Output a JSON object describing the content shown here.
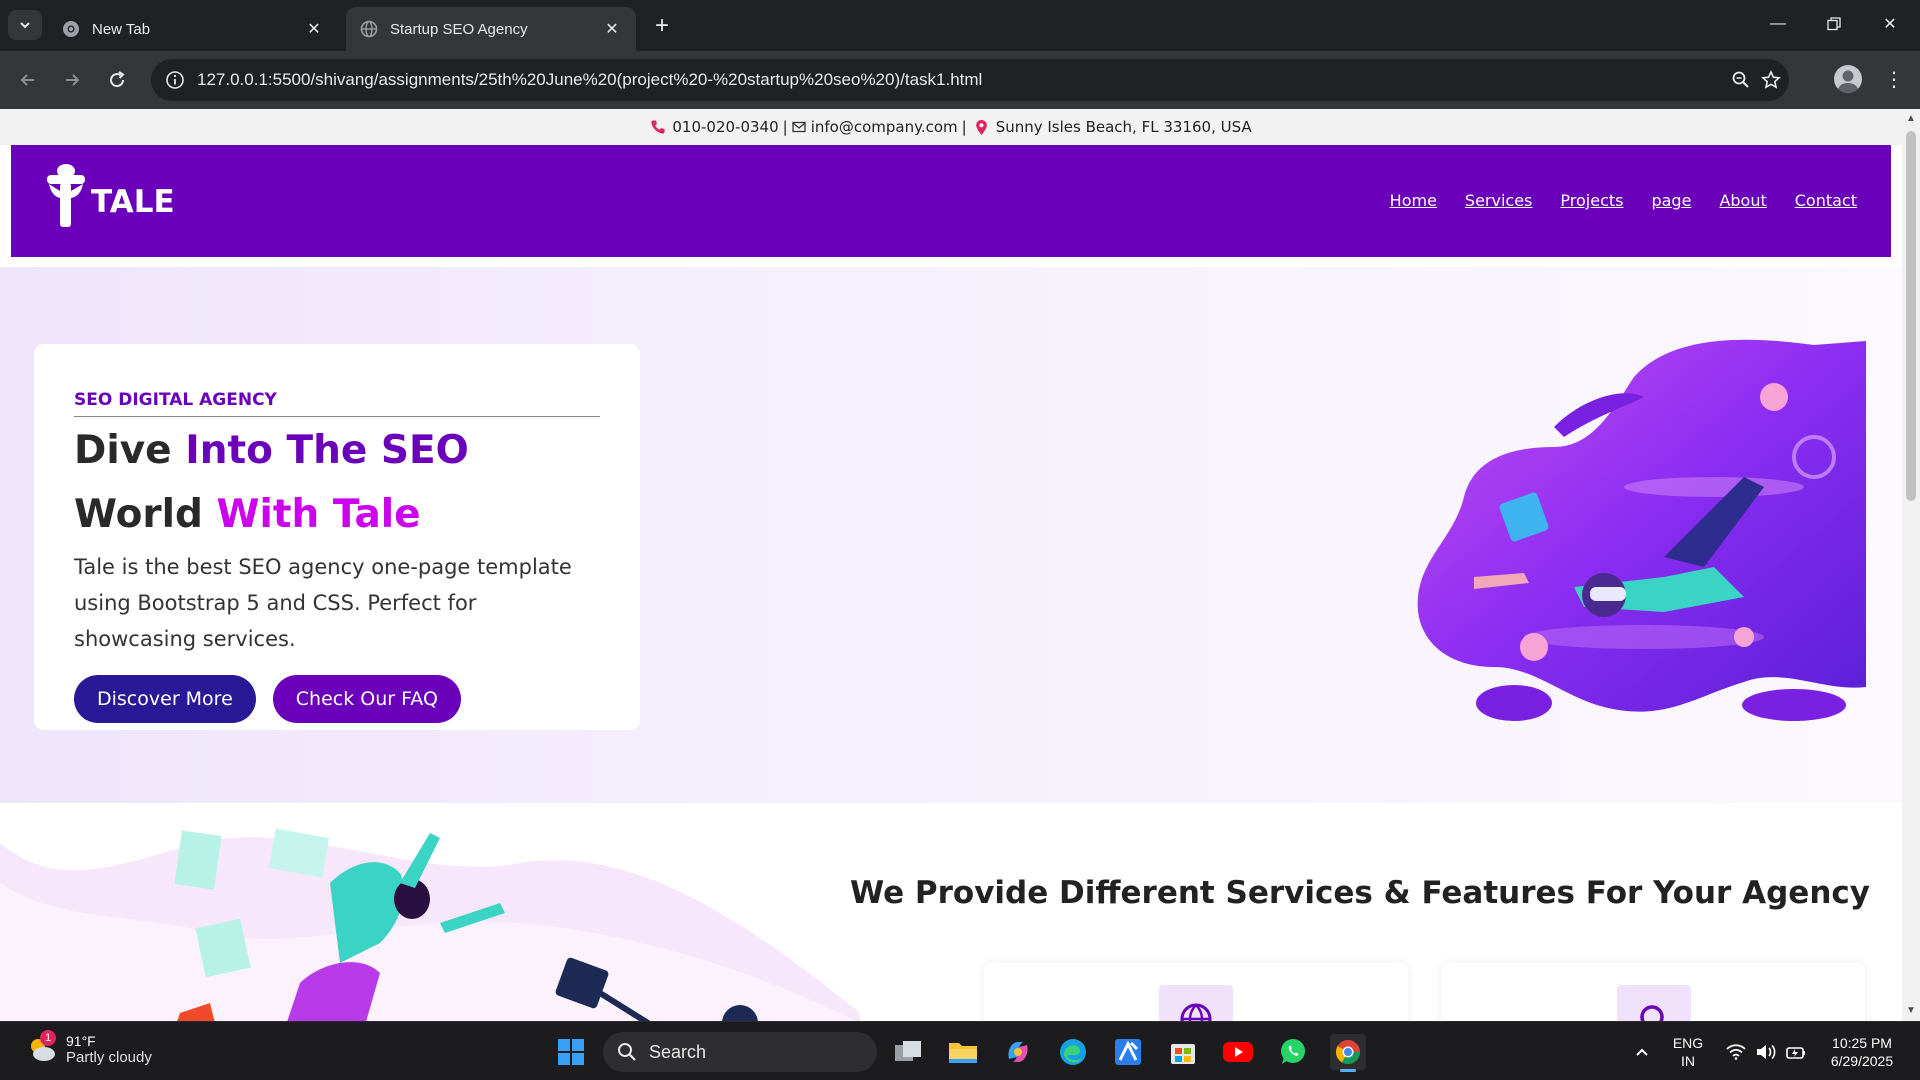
{
  "browser": {
    "tabs": [
      {
        "title": "New Tab",
        "active": false
      },
      {
        "title": "Startup SEO Agency",
        "active": true
      }
    ],
    "url": "127.0.0.1:5500/shivang/assignments/25th%20June%20(project%20-%20startup%20seo%20)/task1.html"
  },
  "topinfo": {
    "phone": "010-020-0340",
    "email": "info@company.com",
    "address": "Sunny Isles Beach, FL 33160, USA",
    "separator": "|"
  },
  "navbar": {
    "logo_text": "TALE",
    "links": [
      "Home",
      "Services",
      "Projects",
      "page",
      "About",
      "Contact"
    ]
  },
  "hero": {
    "eyebrow": "SEO DIGITAL AGENCY",
    "line1_a": "Dive ",
    "line1_b": "Into The SEO",
    "line2_a": "World ",
    "line2_b": "With Tale",
    "description": "Tale is the best SEO agency one-page template using Bootstrap 5 and CSS. Perfect for showcasing services.",
    "btn_primary": "Discover More",
    "btn_secondary": "Check Our FAQ"
  },
  "services": {
    "title": "We Provide Different Services & Features For Your Agency"
  },
  "taskbar": {
    "weather_temp": "91°F",
    "weather_cond": "Partly cloudy",
    "weather_badge": "1",
    "search_label": "Search",
    "lang_top": "ENG",
    "lang_bottom": "IN",
    "time": "10:25 PM",
    "date": "6/29/2025"
  },
  "colors": {
    "brand_purple": "#6a00b9",
    "accent_magenta": "#cc00ee",
    "button_navy": "#2a1996"
  }
}
